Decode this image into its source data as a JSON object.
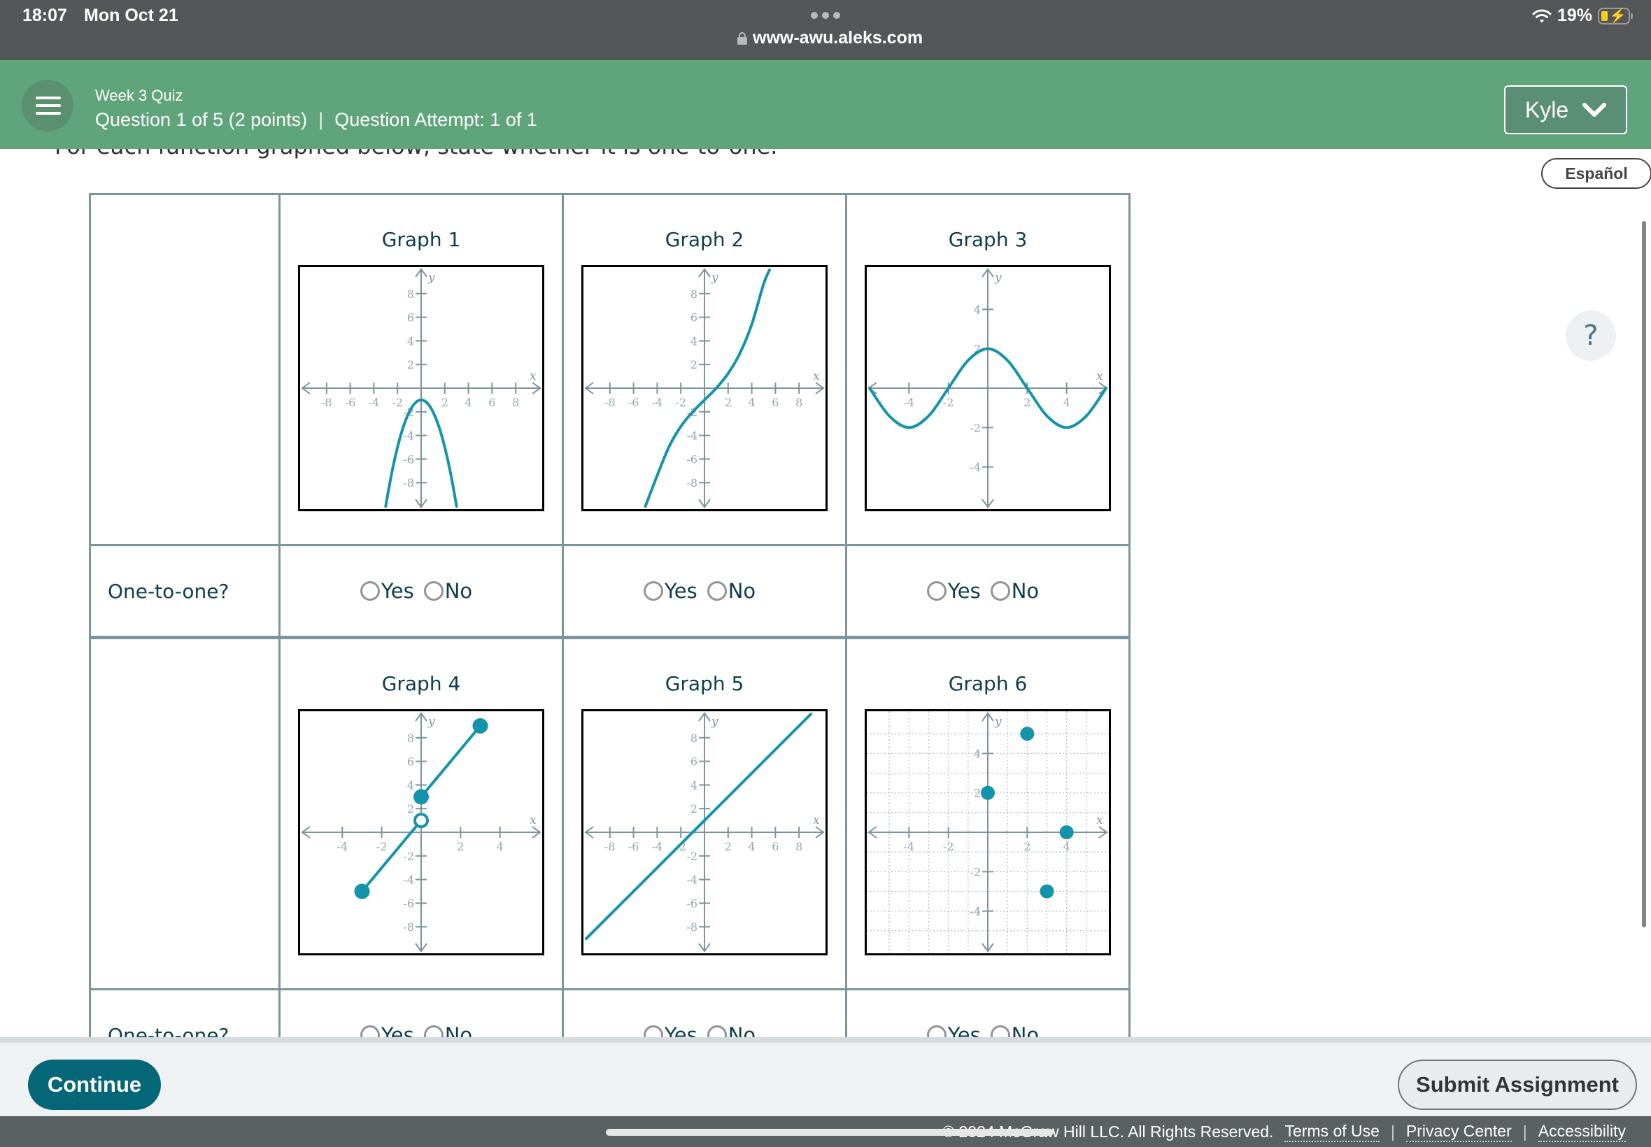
{
  "status_bar": {
    "time": "18:07",
    "date": "Mon Oct 21",
    "url": "www-awu.aleks.com",
    "battery": "19%",
    "battery_level": 0.19
  },
  "header": {
    "quiz_title": "Week 3 Quiz",
    "question_info": "Question 1 of 5 (2 points)",
    "separator": "|",
    "attempt_info": "Question Attempt: 1 of 1",
    "user_name": "Kyle"
  },
  "language_button": "Español",
  "help_icon": "?",
  "instruction": "For each function graphed below, state whether it is one-to-one.",
  "table": {
    "answer_row_label": "One-to-one?",
    "options": [
      "Yes",
      "No"
    ],
    "rows": [
      {
        "graphs": [
          "Graph 1",
          "Graph 2",
          "Graph 3"
        ]
      },
      {
        "graphs": [
          "Graph 4",
          "Graph 5",
          "Graph 6"
        ]
      }
    ]
  },
  "colors": {
    "curve": "#1494aa",
    "axis": "#7b959d",
    "header_green": "#60a47c",
    "continue_teal": "#046677"
  },
  "chart_data": [
    {
      "title": "Graph 1",
      "type": "line",
      "function": "y = -x^2 - 1",
      "xlim": [
        -10,
        10
      ],
      "ylim": [
        -10,
        10
      ],
      "xticks": [
        -8,
        -6,
        -4,
        -2,
        2,
        4,
        6,
        8
      ],
      "yticks": [
        -8,
        -6,
        -4,
        -2,
        2,
        4,
        6,
        8
      ],
      "xlabel": "x",
      "ylabel": "y",
      "grid": false,
      "points": [
        [
          -3,
          -10
        ],
        [
          -2.5,
          -7.25
        ],
        [
          -2,
          -5
        ],
        [
          -1.5,
          -3.25
        ],
        [
          -1,
          -2
        ],
        [
          -0.5,
          -1.25
        ],
        [
          0,
          -1
        ],
        [
          0.5,
          -1.25
        ],
        [
          1,
          -2
        ],
        [
          1.5,
          -3.25
        ],
        [
          2,
          -5
        ],
        [
          2.5,
          -7.25
        ],
        [
          3,
          -10
        ]
      ]
    },
    {
      "title": "Graph 2",
      "type": "line",
      "function": "y ≈ 0.04x^3 + 0.96x - 1",
      "xlim": [
        -10,
        10
      ],
      "ylim": [
        -10,
        10
      ],
      "xticks": [
        -8,
        -6,
        -4,
        -2,
        2,
        4,
        6,
        8
      ],
      "yticks": [
        -8,
        -6,
        -4,
        -2,
        2,
        4,
        6,
        8
      ],
      "xlabel": "x",
      "ylabel": "y",
      "grid": false,
      "points": [
        [
          -5,
          -10
        ],
        [
          -4,
          -7.4
        ],
        [
          -3,
          -4.96
        ],
        [
          -2,
          -3.24
        ],
        [
          -1,
          -2
        ],
        [
          0,
          -1
        ],
        [
          1,
          0
        ],
        [
          2,
          1.24
        ],
        [
          3,
          2.96
        ],
        [
          4,
          5.4
        ],
        [
          5,
          8.8
        ],
        [
          5.5,
          10
        ]
      ]
    },
    {
      "title": "Graph 3",
      "type": "line",
      "function": "y = 2cos(pi x / 4)",
      "xlim": [
        -6,
        6
      ],
      "ylim": [
        -6,
        6
      ],
      "xticks": [
        -4,
        -2,
        2,
        4
      ],
      "yticks": [
        -4,
        -2,
        2,
        4
      ],
      "xlabel": "x",
      "ylabel": "y",
      "grid": false,
      "points": [
        [
          -6,
          0
        ],
        [
          -5,
          -1.41
        ],
        [
          -4,
          -2
        ],
        [
          -3,
          -1.41
        ],
        [
          -2,
          0
        ],
        [
          -1,
          1.41
        ],
        [
          0,
          2
        ],
        [
          1,
          1.41
        ],
        [
          2,
          0
        ],
        [
          3,
          -1.41
        ],
        [
          4,
          -2
        ],
        [
          5,
          -1.41
        ],
        [
          6,
          0
        ]
      ]
    },
    {
      "title": "Graph 4",
      "type": "line",
      "xlim": [
        -6,
        6
      ],
      "ylim": [
        -10,
        10
      ],
      "xticks": [
        -4,
        -2,
        2,
        4
      ],
      "yticks": [
        -8,
        -6,
        -4,
        -2,
        2,
        4,
        6,
        8
      ],
      "xlabel": "x",
      "ylabel": "y",
      "grid": false,
      "segments": [
        {
          "from": [
            -3,
            -5
          ],
          "to": [
            0,
            1
          ],
          "from_closed": true,
          "to_closed": false
        },
        {
          "from": [
            0,
            3
          ],
          "to": [
            3,
            9
          ],
          "from_closed": true,
          "to_closed": true
        }
      ]
    },
    {
      "title": "Graph 5",
      "type": "line",
      "function": "y = x + 1",
      "xlim": [
        -10,
        10
      ],
      "ylim": [
        -10,
        10
      ],
      "xticks": [
        -8,
        -6,
        -4,
        -2,
        2,
        4,
        6,
        8
      ],
      "yticks": [
        -8,
        -6,
        -4,
        -2,
        2,
        4,
        6,
        8
      ],
      "xlabel": "x",
      "ylabel": "y",
      "grid": false,
      "points": [
        [
          -10,
          -9
        ],
        [
          9,
          10
        ]
      ]
    },
    {
      "title": "Graph 6",
      "type": "scatter",
      "xlim": [
        -6,
        6
      ],
      "ylim": [
        -6,
        6
      ],
      "xticks": [
        -4,
        -2,
        2,
        4
      ],
      "yticks": [
        -4,
        -2,
        2,
        4
      ],
      "xlabel": "x",
      "ylabel": "y",
      "grid": true,
      "points": [
        [
          0,
          2
        ],
        [
          2,
          5
        ],
        [
          4,
          0
        ],
        [
          3,
          -3
        ]
      ]
    }
  ],
  "bottom_bar": {
    "continue": "Continue",
    "submit": "Submit Assignment"
  },
  "footer": {
    "copyright": "© 2024 McGraw Hill LLC. All Rights Reserved.",
    "links": [
      "Terms of Use",
      "Privacy Center",
      "Accessibility"
    ]
  }
}
